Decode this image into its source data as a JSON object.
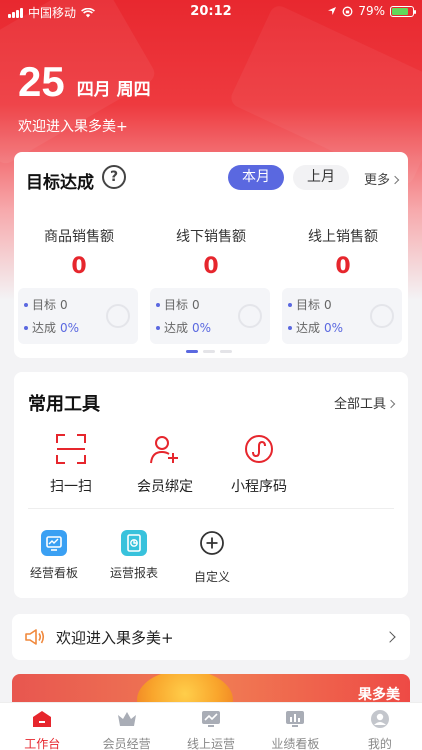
{
  "status": {
    "carrier": "中国移动",
    "time": "20:12",
    "battery": "79%"
  },
  "header": {
    "day": "25",
    "date_rest": "四月 周四",
    "welcome": "欢迎进入果多美+"
  },
  "goal": {
    "title": "目标达成",
    "help_glyph": "?",
    "tabs": [
      {
        "label": "本月",
        "active": true
      },
      {
        "label": "上月",
        "active": false
      }
    ],
    "more": "更多",
    "metrics": [
      {
        "label": "商品销售额",
        "value": "0",
        "target_label": "目标",
        "target": "0",
        "achieve_label": "达成",
        "achieve": "0%"
      },
      {
        "label": "线下销售额",
        "value": "0",
        "target_label": "目标",
        "target": "0",
        "achieve_label": "达成",
        "achieve": "0%"
      },
      {
        "label": "线上销售额",
        "value": "0",
        "target_label": "目标",
        "target": "0",
        "achieve_label": "达成",
        "achieve": "0%"
      }
    ],
    "active_page": 1,
    "pages": 3
  },
  "tools": {
    "title": "常用工具",
    "all": "全部工具",
    "primary": [
      {
        "label": "扫一扫",
        "icon": "scan-icon"
      },
      {
        "label": "会员绑定",
        "icon": "add-member-icon"
      },
      {
        "label": "小程序码",
        "icon": "mini-program-icon"
      }
    ],
    "secondary": [
      {
        "label": "经营看板",
        "icon": "business-board-icon"
      },
      {
        "label": "运营报表",
        "icon": "report-icon"
      },
      {
        "label": "自定义",
        "icon": "plus-circle-icon"
      }
    ]
  },
  "notice": {
    "text": "欢迎进入果多美+",
    "icon": "speaker-icon"
  },
  "banner": {
    "brand": "果多美"
  },
  "tabbar": [
    {
      "label": "工作台",
      "icon": "home-icon",
      "active": true
    },
    {
      "label": "会员经营",
      "icon": "crown-icon",
      "active": false
    },
    {
      "label": "线上运营",
      "icon": "chart-board-icon",
      "active": false
    },
    {
      "label": "业绩看板",
      "icon": "bar-board-icon",
      "active": false
    },
    {
      "label": "我的",
      "icon": "profile-icon",
      "active": false
    }
  ],
  "colors": {
    "brand_red": "#e6262d",
    "accent_blue": "#5a68e0"
  }
}
